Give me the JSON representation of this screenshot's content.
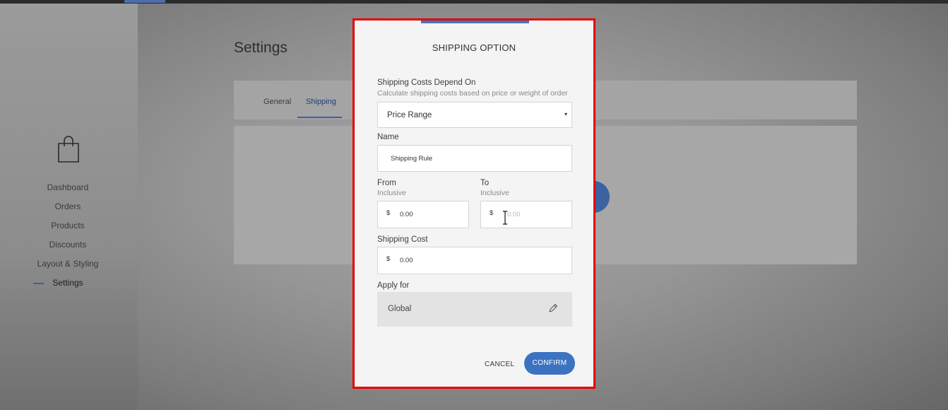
{
  "background": {
    "page_title": "Settings",
    "tabs": [
      {
        "label": "General",
        "active": false
      },
      {
        "label": "Shipping",
        "active": true
      }
    ],
    "sidebar": {
      "logo_icon": "shopping-bag-icon",
      "items": [
        {
          "label": "Dashboard"
        },
        {
          "label": "Orders"
        },
        {
          "label": "Products"
        },
        {
          "label": "Discounts"
        },
        {
          "label": "Layout & Styling"
        },
        {
          "label": "Settings",
          "active": true
        }
      ]
    }
  },
  "modal": {
    "title": "SHIPPING OPTION",
    "depend_on": {
      "label": "Shipping Costs Depend On",
      "hint": "Calculate shipping costs based on price or weight of order",
      "selected": "Price Range",
      "caret": "▾"
    },
    "name": {
      "label": "Name",
      "value": "Shipping Rule"
    },
    "from": {
      "label": "From",
      "hint": "Inclusive",
      "currency": "$",
      "value": "0.00"
    },
    "to": {
      "label": "To",
      "hint": "Inclusive",
      "currency": "$",
      "placeholder": "0.00"
    },
    "shipping_cost": {
      "label": "Shipping Cost",
      "currency": "$",
      "value": "0.00"
    },
    "apply_for": {
      "label": "Apply for",
      "value": "Global",
      "icon": "pencil-icon"
    },
    "buttons": {
      "cancel": "CANCEL",
      "confirm": "CONFIRM"
    }
  },
  "colors": {
    "accent": "#3c72c2",
    "highlight_border": "#e60000"
  }
}
